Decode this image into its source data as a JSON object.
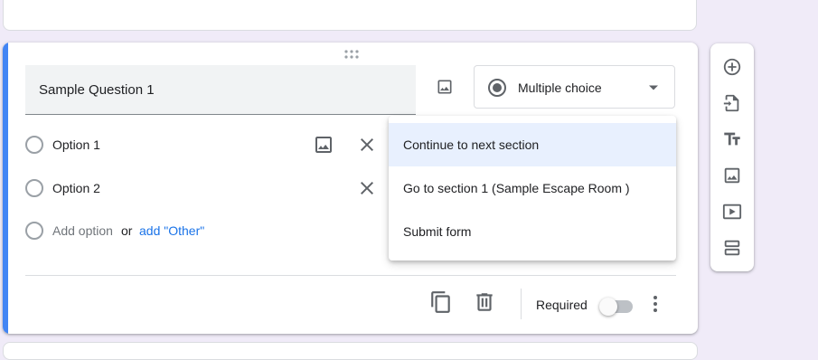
{
  "question": {
    "title": "Sample Question 1",
    "type_label": "Multiple choice",
    "options": [
      {
        "label": "Option 1"
      },
      {
        "label": "Option 2"
      }
    ],
    "add_option": "Add option",
    "or_text": "or",
    "add_other": "add \"Other\""
  },
  "dropdown": {
    "items": [
      {
        "label": "Continue to next section",
        "selected": true
      },
      {
        "label": "Go to section 1 (Sample Escape Room )",
        "selected": false
      },
      {
        "label": "Submit form",
        "selected": false
      }
    ]
  },
  "footer": {
    "required_label": "Required",
    "required_on": false
  },
  "toolbar": {
    "icons": [
      "add-question-icon",
      "import-questions-icon",
      "add-title-icon",
      "add-image-icon",
      "add-video-icon",
      "add-section-icon"
    ]
  },
  "colors": {
    "accent": "#4285f4",
    "background": "#f0ebf8",
    "link": "#1a73e8",
    "selected_item": "#e8f0fe"
  }
}
